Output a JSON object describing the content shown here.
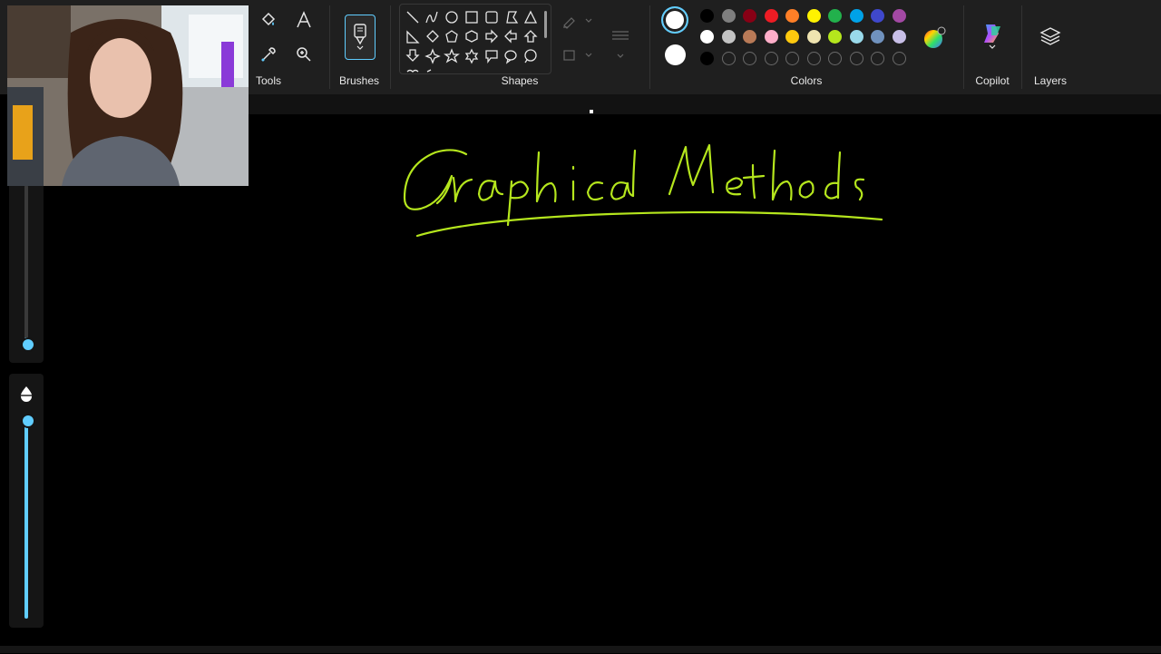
{
  "ribbon": {
    "groups": {
      "tools": "Tools",
      "brushes": "Brushes",
      "shapes": "Shapes",
      "colors": "Colors",
      "copilot": "Copilot",
      "layers": "Layers"
    }
  },
  "tools": [
    "fill-icon",
    "text-icon",
    "color-picker-icon",
    "zoom-icon"
  ],
  "shapes": [
    "line",
    "curve",
    "oval",
    "rectangle",
    "rounded-rectangle",
    "polygon",
    "triangle",
    "right-triangle",
    "diamond",
    "pentagon",
    "hexagon",
    "right-arrow",
    "left-arrow",
    "up-arrow",
    "down-arrow",
    "four-point-star",
    "five-point-star",
    "six-point-star",
    "rect-callout",
    "oval-callout",
    "cloud-callout"
  ],
  "colors": {
    "primary": "#ffffff",
    "secondary": "#ffffff",
    "palette_row1": [
      "#000000",
      "#7f7f7f",
      "#880015",
      "#ed1c24",
      "#ff7f27",
      "#fff200",
      "#22b14c",
      "#00a2e8",
      "#3f48cc",
      "#a349a4"
    ],
    "palette_row2": [
      "#ffffff",
      "#c3c3c3",
      "#b97a57",
      "#ffaec9",
      "#ffc90e",
      "#efe4b0",
      "#b5e61d",
      "#99d9ea",
      "#7092be",
      "#c8bfe7"
    ],
    "custom_row": [
      "#000000",
      "",
      "",
      "",
      "",
      "",
      "",
      "",
      "",
      ""
    ],
    "accent": "#60cdff",
    "ink": "#b5e61d"
  },
  "canvas": {
    "handwritten_title": "Graphical Methods"
  },
  "sliders": {
    "size_level": 1.0,
    "opacity_level": 0.92
  }
}
